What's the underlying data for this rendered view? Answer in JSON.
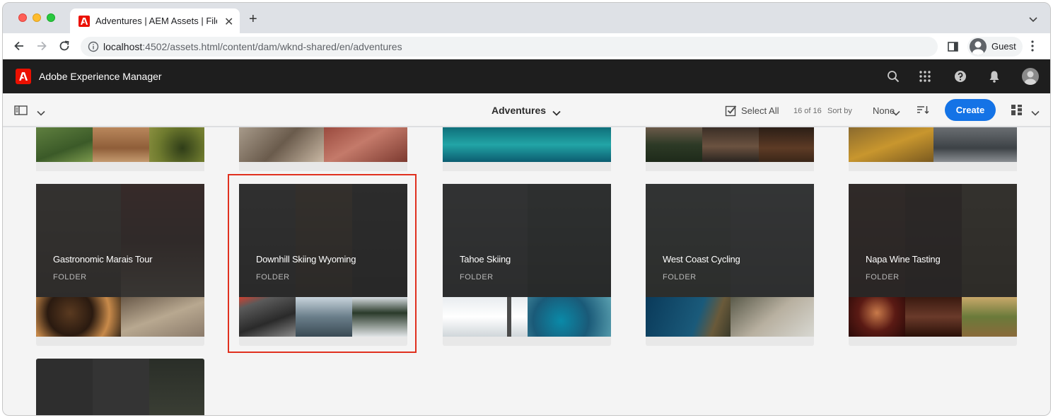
{
  "browser": {
    "tab_title": "Adventures | AEM Assets | Files",
    "url_host": "localhost",
    "url_rest": ":4502/assets.html/content/dam/wknd-shared/en/adventures",
    "profile_name": "Guest"
  },
  "aem": {
    "product_name": "Adobe Experience Manager"
  },
  "actionbar": {
    "title": "Adventures",
    "select_all": "Select All",
    "count": "16 of 16",
    "sort_by_label": "Sort by",
    "sort_value": "None",
    "create_label": "Create"
  },
  "cards": [
    {
      "name": "Gastronomic Marais Tour",
      "type": "FOLDER"
    },
    {
      "name": "Downhill Skiing Wyoming",
      "type": "FOLDER",
      "selected": true
    },
    {
      "name": "Tahoe Skiing",
      "type": "FOLDER"
    },
    {
      "name": "West Coast Cycling",
      "type": "FOLDER"
    },
    {
      "name": "Napa Wine Tasting",
      "type": "FOLDER"
    }
  ],
  "colors": {
    "accent": "#1473e6",
    "header_bg": "#1e1e1e",
    "adobe_red": "#eb1000",
    "selection_outline": "#e0301e"
  }
}
